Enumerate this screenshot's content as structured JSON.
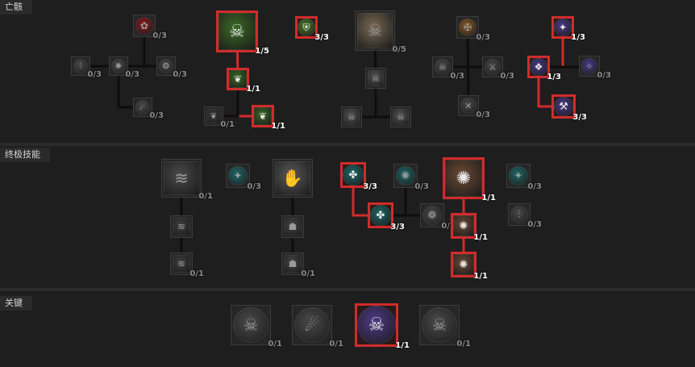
{
  "sections": [
    {
      "title": "亡骸"
    },
    {
      "title": "终极技能"
    },
    {
      "title": "关键"
    }
  ],
  "nodes": [
    {
      "id": "n1",
      "section": 0,
      "count": "0/3",
      "active": false,
      "shape": "circle",
      "color": "#8c1c1c",
      "glyph": "✿",
      "icon": "blood-rose-icon"
    },
    {
      "id": "n2",
      "section": 0,
      "count": "0/3",
      "active": false,
      "shape": "circle",
      "color": "#4a4a4a",
      "glyph": "⫶",
      "icon": "bone-spikes-icon"
    },
    {
      "id": "n3",
      "section": 0,
      "count": "0/3",
      "active": false,
      "shape": "circle",
      "color": "#4a4a4a",
      "glyph": "✺",
      "icon": "bone-burst-icon"
    },
    {
      "id": "n4",
      "section": 0,
      "count": "0/3",
      "active": false,
      "shape": "circle",
      "color": "#4a4a4a",
      "glyph": "❂",
      "icon": "orbs-icon"
    },
    {
      "id": "n5",
      "section": 0,
      "count": "0/3",
      "active": false,
      "shape": "circle",
      "color": "#4a4a4a",
      "glyph": "☄",
      "icon": "crescent-icon"
    },
    {
      "id": "n6",
      "section": 0,
      "count": "1/5",
      "active": true,
      "shape": "square",
      "color": "#3b6b24",
      "glyph": "☠",
      "icon": "corpse-tendrils-icon"
    },
    {
      "id": "n7",
      "section": 0,
      "count": "1/1",
      "active": true,
      "shape": "square",
      "color": "#3b6b24",
      "glyph": "❦",
      "icon": "enhanced-tendrils-icon"
    },
    {
      "id": "n8",
      "section": 0,
      "count": "0/1",
      "active": false,
      "shape": "square",
      "color": "#3a3a3a",
      "glyph": "❦",
      "icon": "plagued-tendrils-icon"
    },
    {
      "id": "n9",
      "section": 0,
      "count": "1/1",
      "active": true,
      "shape": "square",
      "color": "#3b6b24",
      "glyph": "❦",
      "icon": "blighted-tendrils-icon"
    },
    {
      "id": "n10",
      "section": 0,
      "count": "3/3",
      "active": true,
      "shape": "circle",
      "color": "#4c7a2a",
      "glyph": "⛨",
      "icon": "necrotic-carapace-icon"
    },
    {
      "id": "n11",
      "section": 0,
      "count": "0/5",
      "active": false,
      "shape": "square",
      "color": "#7a6a55",
      "glyph": "☠",
      "icon": "skeleton-icon"
    },
    {
      "id": "n12",
      "section": 0,
      "count": "",
      "active": false,
      "shape": "square",
      "color": "#555555",
      "glyph": "☠",
      "icon": "skeleton-enhanced-icon"
    },
    {
      "id": "n13",
      "section": 0,
      "count": "",
      "active": false,
      "shape": "square",
      "color": "#555555",
      "glyph": "☠",
      "icon": "skeleton-left-icon"
    },
    {
      "id": "n14",
      "section": 0,
      "count": "",
      "active": false,
      "shape": "square",
      "color": "#555555",
      "glyph": "☠",
      "icon": "skeleton-right-icon"
    },
    {
      "id": "n15",
      "section": 0,
      "count": "0/3",
      "active": false,
      "shape": "circle",
      "color": "#8a5a22",
      "glyph": "✠",
      "icon": "crossed-bones-orange-icon"
    },
    {
      "id": "n16",
      "section": 0,
      "count": "0/3",
      "active": false,
      "shape": "circle",
      "color": "#4a4a4a",
      "glyph": "☠",
      "icon": "skull-crossbones-icon"
    },
    {
      "id": "n17",
      "section": 0,
      "count": "0/3",
      "active": false,
      "shape": "circle",
      "color": "#4a4a4a",
      "glyph": "⚔",
      "icon": "axe-icon"
    },
    {
      "id": "n18",
      "section": 0,
      "count": "0/3",
      "active": false,
      "shape": "circle",
      "color": "#4a4a4a",
      "glyph": "✕",
      "icon": "crossed-swords-icon"
    },
    {
      "id": "n19",
      "section": 0,
      "count": "1/3",
      "active": true,
      "shape": "circle",
      "color": "#4a3a8a",
      "glyph": "✦",
      "icon": "purple-rune-icon"
    },
    {
      "id": "n20",
      "section": 0,
      "count": "1/3",
      "active": true,
      "shape": "circle",
      "color": "#4a3a8a",
      "glyph": "❖",
      "icon": "purple-sigil-icon"
    },
    {
      "id": "n21",
      "section": 0,
      "count": "0/3",
      "active": false,
      "shape": "circle",
      "color": "#4a3a8a",
      "glyph": "✧",
      "icon": "purple-shard-icon"
    },
    {
      "id": "n22",
      "section": 0,
      "count": "3/3",
      "active": true,
      "shape": "circle",
      "color": "#4a3a8a",
      "glyph": "⚒",
      "icon": "purple-axe-icon"
    },
    {
      "id": "u1",
      "section": 1,
      "count": "0/1",
      "active": false,
      "shape": "square",
      "color": "#4a4a4a",
      "glyph": "≋",
      "icon": "bone-storm-icon"
    },
    {
      "id": "u2",
      "section": 1,
      "count": "",
      "active": false,
      "shape": "square",
      "color": "#3e3e3e",
      "glyph": "≋",
      "icon": "bone-storm-enhanced-icon"
    },
    {
      "id": "u3",
      "section": 1,
      "count": "0/1",
      "active": false,
      "shape": "square",
      "color": "#3e3e3e",
      "glyph": "≋",
      "icon": "bone-storm-upgrade-icon"
    },
    {
      "id": "u4",
      "section": 1,
      "count": "0/3",
      "active": false,
      "shape": "circle",
      "color": "#1e6a6a",
      "glyph": "✦",
      "icon": "teal-rune-icon"
    },
    {
      "id": "u5",
      "section": 1,
      "count": "",
      "active": false,
      "shape": "square",
      "color": "#5a5a5a",
      "glyph": "✋",
      "icon": "army-of-dead-icon"
    },
    {
      "id": "u6",
      "section": 1,
      "count": "",
      "active": false,
      "shape": "square",
      "color": "#454545",
      "glyph": "☗",
      "icon": "army-enhanced-icon"
    },
    {
      "id": "u7",
      "section": 1,
      "count": "0/1",
      "active": false,
      "shape": "square",
      "color": "#454545",
      "glyph": "☗",
      "icon": "army-upgrade-icon"
    },
    {
      "id": "u8",
      "section": 1,
      "count": "3/3",
      "active": true,
      "shape": "circle",
      "color": "#1e6a6a",
      "glyph": "✤",
      "icon": "teal-leaf-icon"
    },
    {
      "id": "u9",
      "section": 1,
      "count": "0/3",
      "active": false,
      "shape": "circle",
      "color": "#1e6a6a",
      "glyph": "✺",
      "icon": "teal-swirl-icon"
    },
    {
      "id": "u10",
      "section": 1,
      "count": "3/3",
      "active": true,
      "shape": "circle",
      "color": "#1e6a6a",
      "glyph": "✤",
      "icon": "teal-bloom-icon"
    },
    {
      "id": "u11",
      "section": 1,
      "count": "0/3",
      "active": false,
      "shape": "circle",
      "color": "#4a4a4a",
      "glyph": "❁",
      "icon": "grey-orb-icon"
    },
    {
      "id": "u12",
      "section": 1,
      "count": "1/1",
      "active": true,
      "shape": "square",
      "color": "#6a4a34",
      "glyph": "✺",
      "icon": "blood-wave-icon"
    },
    {
      "id": "u13",
      "section": 1,
      "count": "1/1",
      "active": true,
      "shape": "square",
      "color": "#6a4a34",
      "glyph": "✺",
      "icon": "blood-wave-enhanced-icon"
    },
    {
      "id": "u14",
      "section": 1,
      "count": "1/1",
      "active": true,
      "shape": "square",
      "color": "#6a4a34",
      "glyph": "✺",
      "icon": "blood-wave-upgrade-icon"
    },
    {
      "id": "u15",
      "section": 1,
      "count": "0/3",
      "active": false,
      "shape": "circle",
      "color": "#1e6a6a",
      "glyph": "✦",
      "icon": "teal-gem-icon"
    },
    {
      "id": "u16",
      "section": 1,
      "count": "0/3",
      "active": false,
      "shape": "circle",
      "color": "#4a4a4a",
      "glyph": "⫶",
      "icon": "grey-bones-icon"
    },
    {
      "id": "k1",
      "section": 2,
      "count": "0/1",
      "active": false,
      "shape": "circle",
      "color": "#4a4a4a",
      "glyph": "☠",
      "icon": "skull-crossbones-key-icon"
    },
    {
      "id": "k2",
      "section": 2,
      "count": "0/1",
      "active": false,
      "shape": "circle",
      "color": "#4a4a4a",
      "glyph": "☄",
      "icon": "helm-key-icon"
    },
    {
      "id": "k3",
      "section": 2,
      "count": "1/1",
      "active": true,
      "shape": "circle",
      "color": "#4e3a86",
      "glyph": "☠",
      "icon": "purple-skull-key-icon"
    },
    {
      "id": "k4",
      "section": 2,
      "count": "0/1",
      "active": false,
      "shape": "circle",
      "color": "#4a4a4a",
      "glyph": "☠",
      "icon": "skull-pile-key-icon"
    }
  ],
  "links": [
    {
      "a": "n1",
      "b": "n3",
      "active": false
    },
    {
      "a": "n2",
      "b": "n4",
      "active": false
    },
    {
      "a": "n3",
      "b": "n5",
      "active": false
    },
    {
      "a": "n6",
      "b": "n7",
      "active": true
    },
    {
      "a": "n7",
      "b": "n9",
      "active": true
    },
    {
      "a": "n7",
      "b": "n8",
      "active": false
    },
    {
      "a": "n11",
      "b": "n12",
      "active": false
    },
    {
      "a": "n12",
      "b": "n13",
      "active": false
    },
    {
      "a": "n12",
      "b": "n14",
      "active": false
    },
    {
      "a": "n15",
      "b": "n18",
      "active": false
    },
    {
      "a": "n16",
      "b": "n17",
      "active": false
    },
    {
      "a": "n19",
      "b": "n20",
      "active": true
    },
    {
      "a": "n20",
      "b": "n22",
      "active": true
    },
    {
      "a": "n21",
      "b": "n20",
      "active": false
    },
    {
      "a": "u1",
      "b": "u2",
      "active": false
    },
    {
      "a": "u2",
      "b": "u3",
      "active": false
    },
    {
      "a": "u5",
      "b": "u6",
      "active": false
    },
    {
      "a": "u6",
      "b": "u7",
      "active": false
    },
    {
      "a": "u8",
      "b": "u10",
      "active": true
    },
    {
      "a": "u10",
      "b": "u11",
      "active": false
    },
    {
      "a": "u9",
      "b": "u10",
      "active": false
    },
    {
      "a": "u12",
      "b": "u13",
      "active": true
    },
    {
      "a": "u13",
      "b": "u14",
      "active": true
    },
    {
      "a": "u11",
      "b": "u13",
      "active": false
    }
  ]
}
